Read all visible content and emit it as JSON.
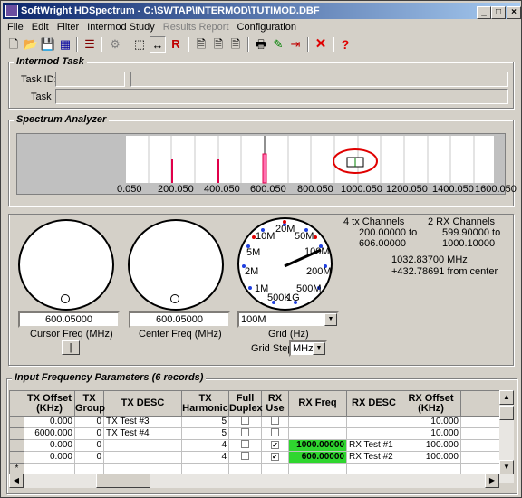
{
  "window": {
    "title": "SoftWright HDSpectrum - C:\\SWTAP\\INTERMOD\\TUTIMOD.DBF"
  },
  "menu": [
    "File",
    "Edit",
    "Filter",
    "Intermod Study",
    "Results Report",
    "Configuration"
  ],
  "intermod_task": {
    "title": "Intermod Task",
    "task_id_label": "Task ID:",
    "task_label": "Task",
    "task_id_value": "",
    "task_value": ""
  },
  "spectrum": {
    "title": "Spectrum Analyzer",
    "ticks": [
      "0.050",
      "200.050",
      "400.050",
      "600.050",
      "800.050",
      "1000.050",
      "1200.050",
      "1400.050",
      "1600.050"
    ]
  },
  "controls": {
    "cursor_freq_value": "600.05000",
    "cursor_freq_label": "Cursor Freq (MHz)",
    "center_freq_value": "600.05000",
    "center_freq_label": "Center Freq (MHz)",
    "grid_value": "100M",
    "grid_label": "Grid (Hz)",
    "grid_step_label": "Grid Step",
    "grid_step_value": "MHz",
    "dial_labels": [
      "20M",
      "10M",
      "50M",
      "5M",
      "100M",
      "2M",
      "200M",
      "1M",
      "500M",
      "500K",
      "1G"
    ],
    "tx_channels": "4 tx Channels",
    "tx_range_1": "200.00000 to",
    "tx_range_2": "606.00000",
    "rx_channels": "2 RX Channels",
    "rx_range_1": "599.90000 to",
    "rx_range_2": "1000.10000",
    "cursor_mhz": "1032.83700 MHz",
    "offset_text": "+432.78691 from center"
  },
  "table": {
    "title": "Input Frequency Parameters (6 records)",
    "headers": [
      "TX Offset (KHz)",
      "TX Group",
      "TX DESC",
      "TX Harmonic",
      "Full Duplex",
      "RX Use",
      "RX Freq",
      "RX DESC",
      "RX Offset (KHz)"
    ],
    "rows": [
      {
        "tx_offset": "0.000",
        "tx_group": "0",
        "tx_desc": "TX Test #3",
        "tx_harmonic": "5",
        "full_duplex": false,
        "rx_use": false,
        "rx_freq": "",
        "rx_desc": "",
        "rx_offset": "10.000"
      },
      {
        "tx_offset": "6000.000",
        "tx_group": "0",
        "tx_desc": "TX Test #4",
        "tx_harmonic": "5",
        "full_duplex": false,
        "rx_use": false,
        "rx_freq": "",
        "rx_desc": "",
        "rx_offset": "10.000"
      },
      {
        "tx_offset": "0.000",
        "tx_group": "0",
        "tx_desc": "",
        "tx_harmonic": "4",
        "full_duplex": false,
        "rx_use": true,
        "rx_freq": "1000.00000",
        "rx_desc": "RX Test #1",
        "rx_offset": "100.000"
      },
      {
        "tx_offset": "0.000",
        "tx_group": "0",
        "tx_desc": "",
        "tx_harmonic": "4",
        "full_duplex": false,
        "rx_use": true,
        "rx_freq": "600.00000",
        "rx_desc": "RX Test #2",
        "rx_offset": "100.000"
      }
    ],
    "new_row_marker": "*"
  },
  "colors": {
    "title_start": "#0a246a",
    "title_end": "#a6caf0",
    "tx_marker": "#e0004a",
    "rx_highlight": "#2fd62f",
    "annotation_circle": "#e00000"
  }
}
